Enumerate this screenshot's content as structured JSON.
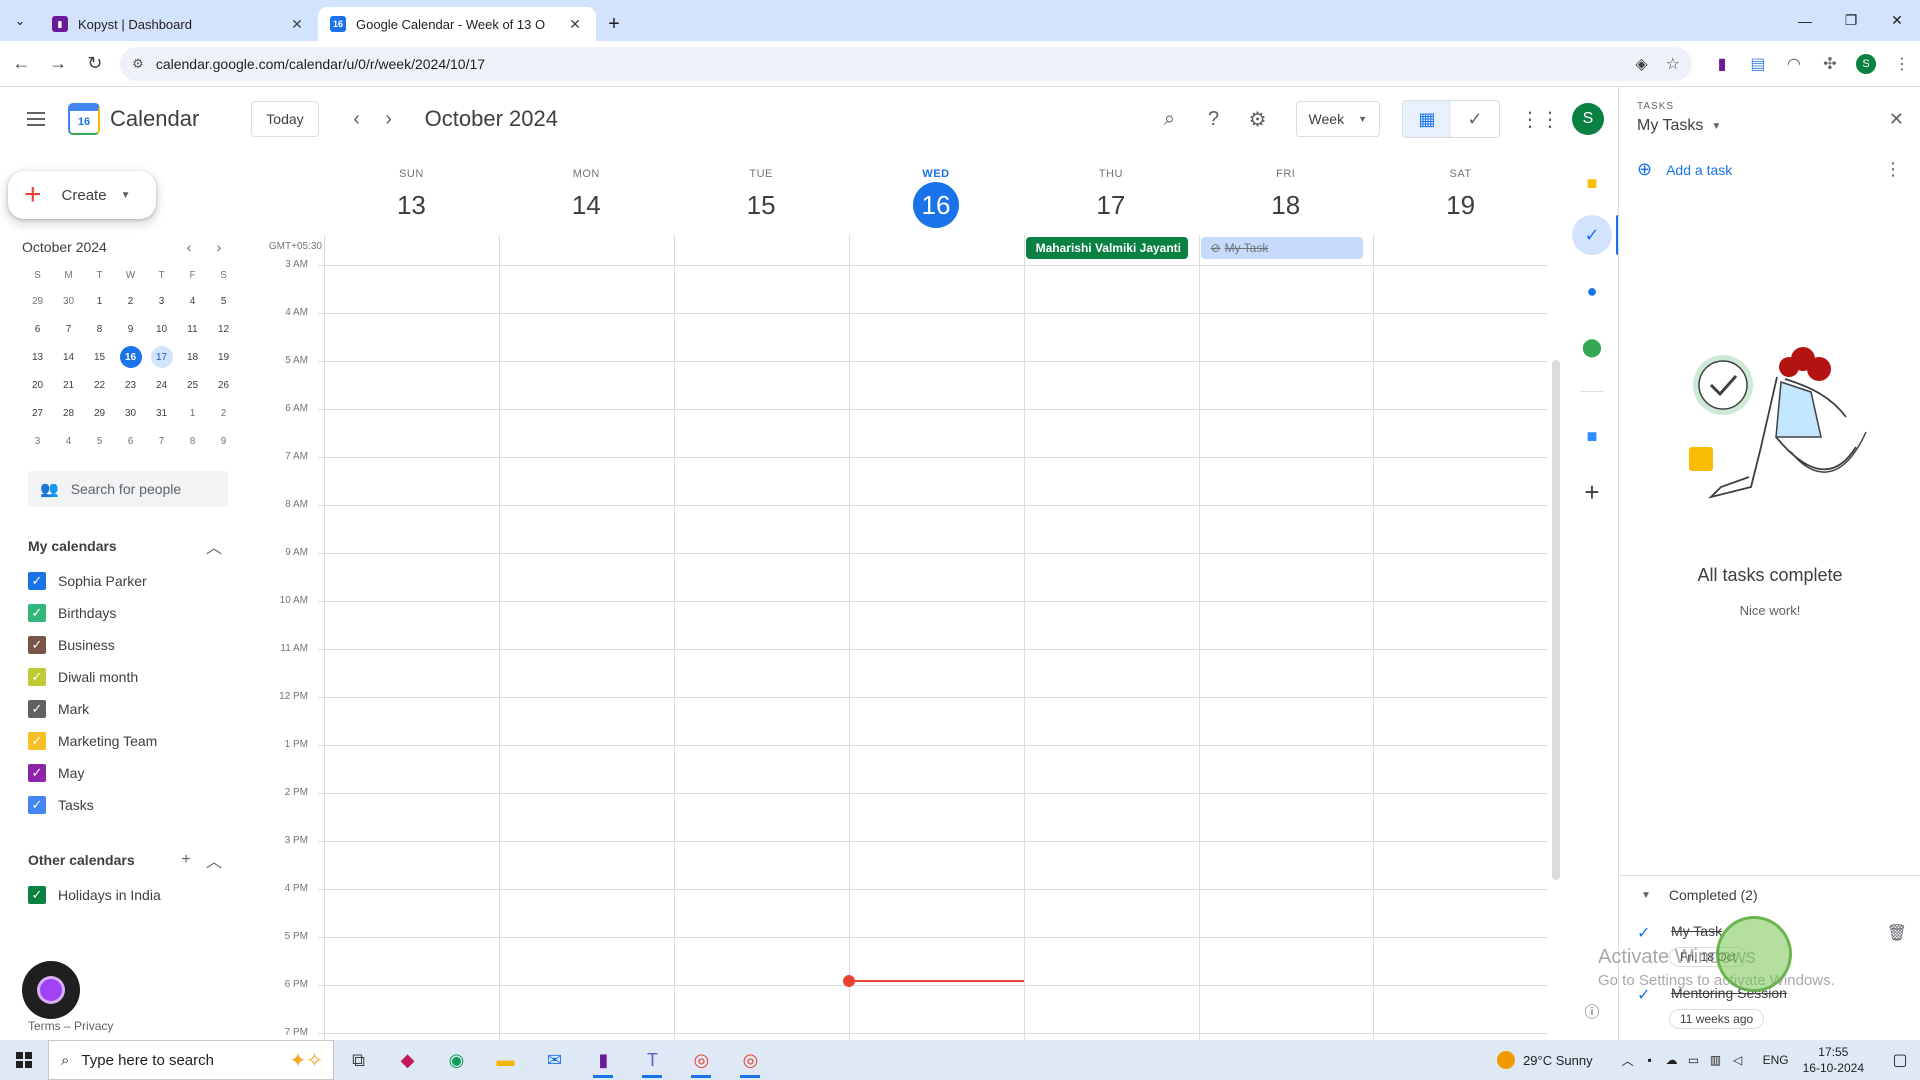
{
  "browser": {
    "tabs": [
      {
        "title": "Kopyst | Dashboard",
        "active": false,
        "favicon_color": "#6a1b9a"
      },
      {
        "title": "Google Calendar - Week of 13 O",
        "active": true,
        "favicon_color": "#1a73e8",
        "favicon_text": "16"
      }
    ],
    "url": "calendar.google.com/calendar/u/0/r/week/2024/10/17",
    "profile_initial": "S"
  },
  "header": {
    "app_title": "Calendar",
    "logo_text": "16",
    "today_label": "Today",
    "period_title": "October 2024",
    "view_label": "Week",
    "user_initial": "S"
  },
  "sidebar": {
    "create_label": "Create",
    "mini_calendar": {
      "title": "October 2024",
      "dow": [
        "S",
        "M",
        "T",
        "W",
        "T",
        "F",
        "S"
      ],
      "weeks": [
        [
          "29",
          "30",
          "1",
          "2",
          "3",
          "4",
          "5"
        ],
        [
          "6",
          "7",
          "8",
          "9",
          "10",
          "11",
          "12"
        ],
        [
          "13",
          "14",
          "15",
          "16",
          "17",
          "18",
          "19"
        ],
        [
          "20",
          "21",
          "22",
          "23",
          "24",
          "25",
          "26"
        ],
        [
          "27",
          "28",
          "29",
          "30",
          "31",
          "1",
          "2"
        ],
        [
          "3",
          "4",
          "5",
          "6",
          "7",
          "8",
          "9"
        ]
      ],
      "today": "16",
      "selected": "17"
    },
    "people_search_placeholder": "Search for people",
    "my_calendars_title": "My calendars",
    "my_calendars": [
      {
        "name": "Sophia Parker",
        "color": "#1a73e8"
      },
      {
        "name": "Birthdays",
        "color": "#33b679"
      },
      {
        "name": "Business",
        "color": "#795548"
      },
      {
        "name": "Diwali month",
        "color": "#c0ca33"
      },
      {
        "name": "Mark",
        "color": "#616161"
      },
      {
        "name": "Marketing Team",
        "color": "#f6bf26"
      },
      {
        "name": "May",
        "color": "#8e24aa"
      },
      {
        "name": "Tasks",
        "color": "#4285f4"
      }
    ],
    "other_calendars_title": "Other calendars",
    "other_calendars": [
      {
        "name": "Holidays in India",
        "color": "#0b8043"
      }
    ],
    "terms": "Terms",
    "privacy": "Privacy",
    "terms_separator": "–"
  },
  "week": {
    "timezone": "GMT+05:30",
    "days": [
      {
        "dow": "SUN",
        "num": "13",
        "today": false
      },
      {
        "dow": "MON",
        "num": "14",
        "today": false
      },
      {
        "dow": "TUE",
        "num": "15",
        "today": false
      },
      {
        "dow": "WED",
        "num": "16",
        "today": true
      },
      {
        "dow": "THU",
        "num": "17",
        "today": false
      },
      {
        "dow": "FRI",
        "num": "18",
        "today": false
      },
      {
        "dow": "SAT",
        "num": "19",
        "today": false
      }
    ],
    "all_day_events": [
      {
        "title": "Maharishi Valmiki Jayanti",
        "day_index": 4,
        "kind": "holiday"
      },
      {
        "title": "My Task",
        "day_index": 5,
        "kind": "task"
      }
    ],
    "hours": [
      "3 AM",
      "4 AM",
      "5 AM",
      "6 AM",
      "7 AM",
      "8 AM",
      "9 AM",
      "10 AM",
      "11 AM",
      "12 PM",
      "1 PM",
      "2 PM",
      "3 PM",
      "4 PM",
      "5 PM",
      "6 PM",
      "7 PM"
    ],
    "current_time": {
      "day_index": 3,
      "time": "17:55"
    }
  },
  "tasks_panel": {
    "label": "TASKS",
    "list_name": "My Tasks",
    "add_label": "Add a task",
    "empty_title": "All tasks complete",
    "empty_subtitle": "Nice work!",
    "completed_label": "Completed (2)",
    "completed": [
      {
        "name": "My Task",
        "meta": "Fri, 18 Oct"
      },
      {
        "name": "Mentoring Session",
        "meta": "11 weeks ago"
      }
    ]
  },
  "watermark": {
    "line1": "Activate Windows",
    "line2": "Go to Settings to activate Windows."
  },
  "taskbar": {
    "search_placeholder": "Type here to search",
    "weather": "29°C  Sunny",
    "language": "ENG",
    "time": "17:55",
    "date": "16-10-2024"
  }
}
